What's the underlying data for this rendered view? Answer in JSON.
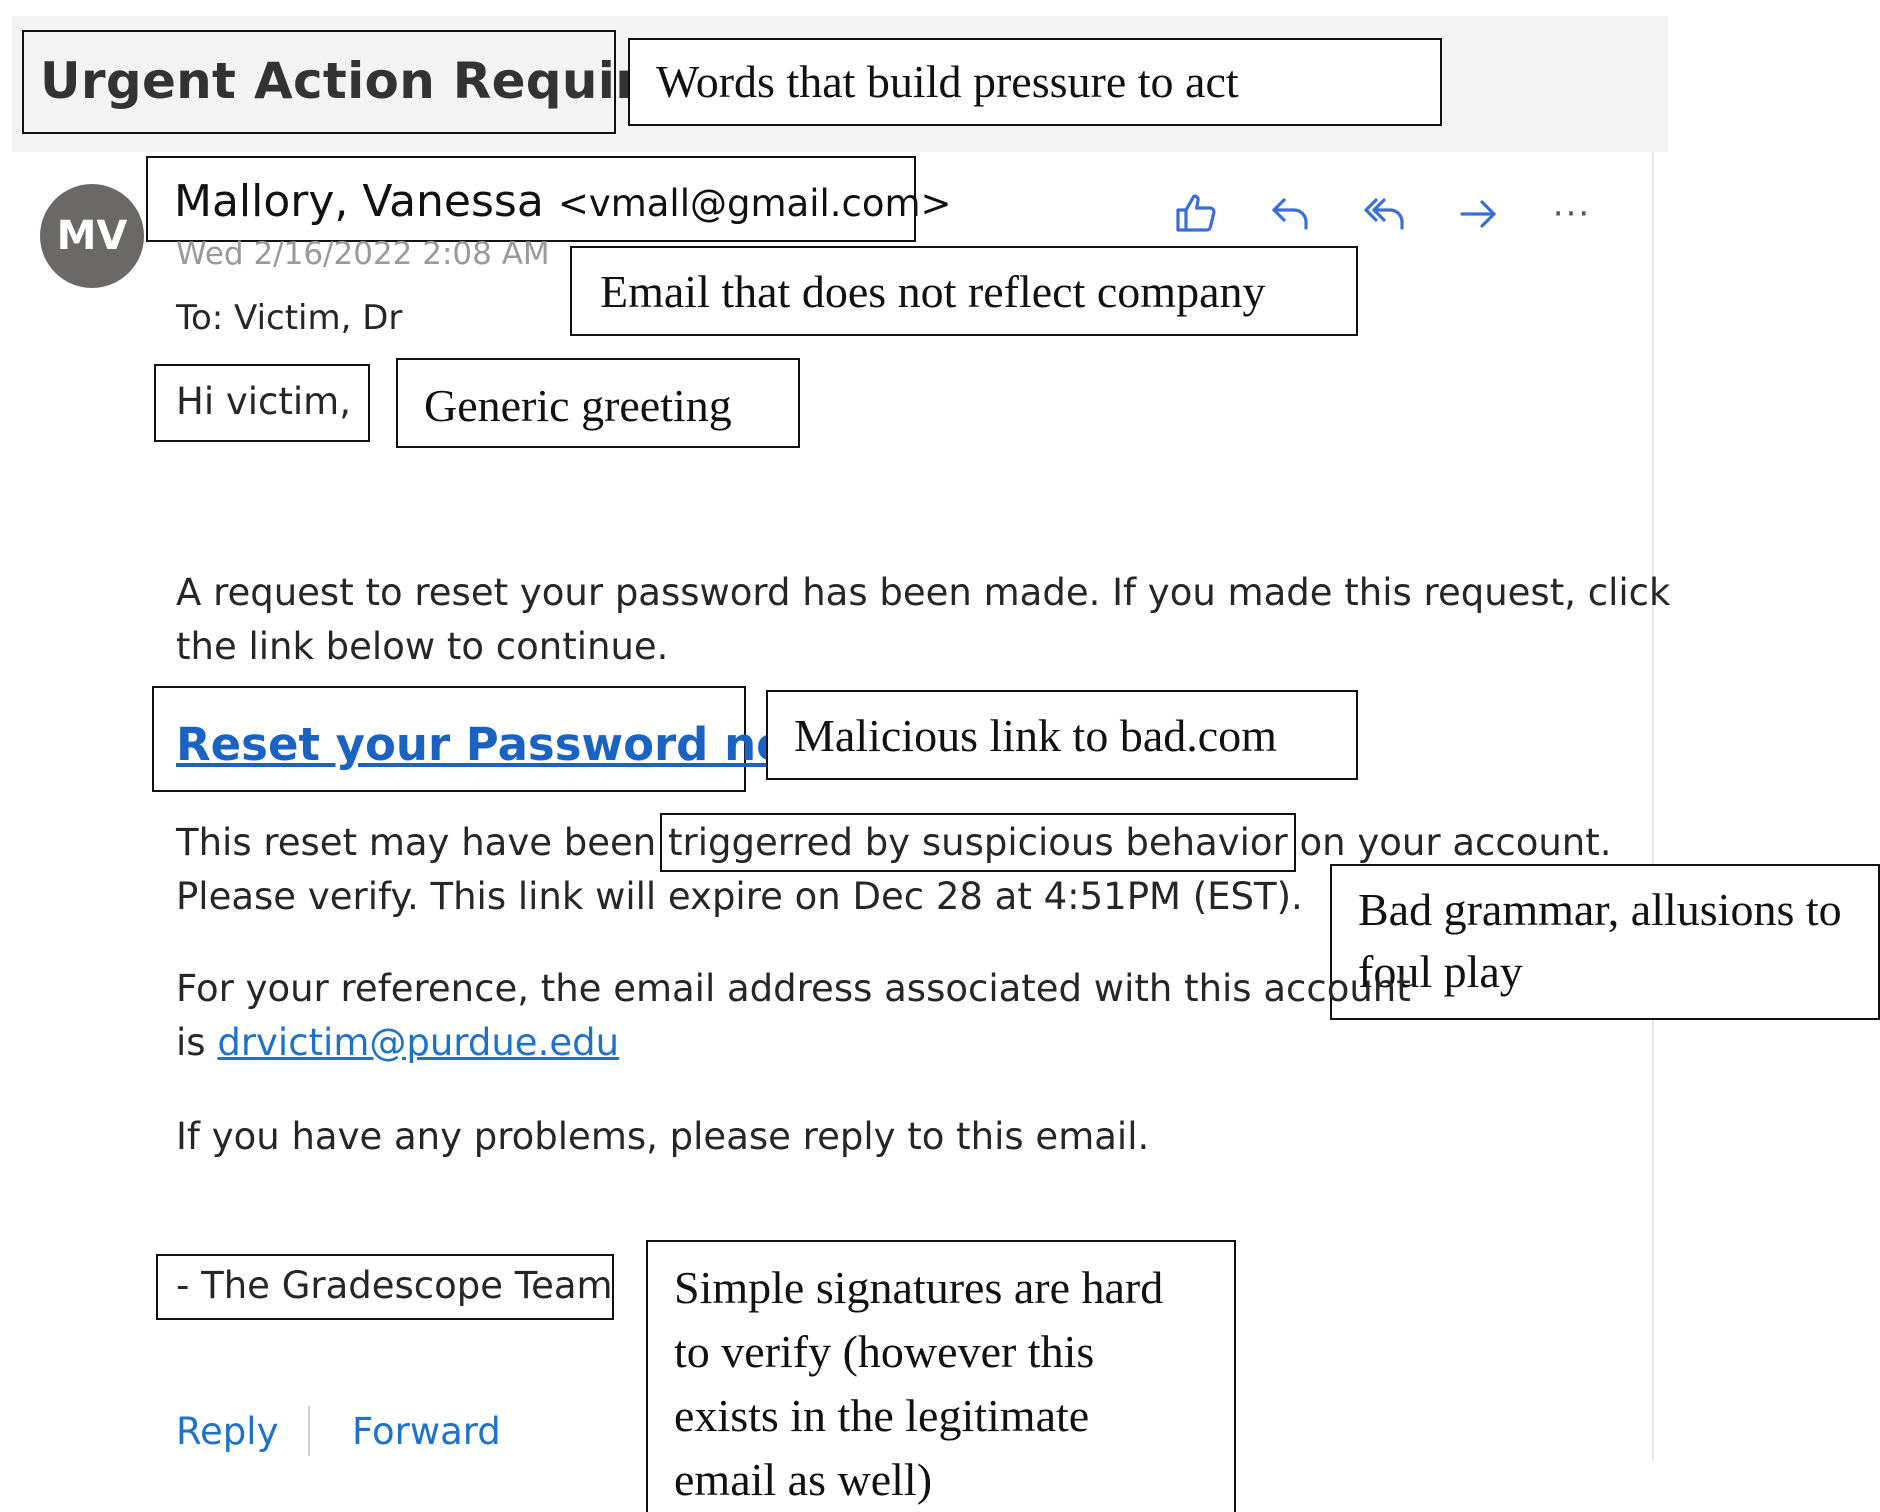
{
  "email": {
    "subject": "Urgent Action Required!",
    "avatar_initials": "MV",
    "sender_name": "Mallory, Vanessa",
    "sender_email": "<vmall@gmail.com>",
    "date": "Wed 2/16/2022 2:08 AM",
    "to": "To: Victim, Dr",
    "greeting": "Hi victim,",
    "para1_line1": "A request to reset your password has been made. If you made this request, click",
    "para1_line2": "the link below to continue.",
    "reset_link": "Reset your Password now!",
    "para2_line1_pre": "This reset may have been ",
    "para2_line1_highlight": "triggerred by suspicious behavior",
    "para2_line1_post": " on your account.",
    "para2_line2": "Please verify. This link will expire on Dec 28 at 4:51PM (EST).",
    "para3_line1": "For your reference, the email address associated with this account",
    "para3_line2_pre": "is ",
    "para3_email": "drvictim@purdue.edu",
    "para4": "If you have any problems, please reply to this email.",
    "signature": "- The Gradescope Team",
    "reply": "Reply",
    "forward": "Forward"
  },
  "toolbar": {
    "icons": [
      "thumbs-up-icon",
      "reply-icon",
      "reply-all-icon",
      "forward-icon",
      "more-icon"
    ],
    "more_label": "···"
  },
  "annotations": {
    "pressure": "Words that build pressure to act",
    "company_email": "Email that does not reflect company",
    "generic_greeting": "Generic greeting",
    "malicious_link": "Malicious link to bad.com",
    "bad_grammar_line1": "Bad grammar, allusions to",
    "bad_grammar_line2": "foul play",
    "signature_line1": "Simple signatures are hard",
    "signature_line2": "to verify (however this",
    "signature_line3": "exists in the legitimate",
    "signature_line4": "email as well)"
  },
  "colors": {
    "link": "#1e73c8",
    "toolbar_icon": "#3a6fd8",
    "avatar_bg": "#6b6868",
    "header_bg": "#f3f3f3"
  }
}
